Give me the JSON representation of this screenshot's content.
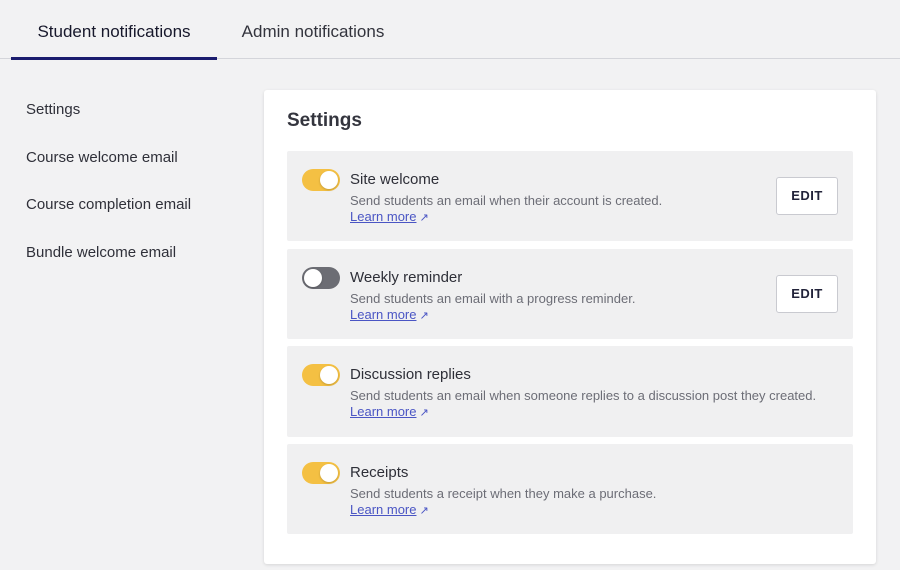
{
  "tabs": [
    {
      "label": "Student notifications",
      "active": true
    },
    {
      "label": "Admin notifications",
      "active": false
    }
  ],
  "sidebar": {
    "items": [
      {
        "label": "Settings"
      },
      {
        "label": "Course welcome email"
      },
      {
        "label": "Course completion email"
      },
      {
        "label": "Bundle welcome email"
      }
    ]
  },
  "settings": {
    "title": "Settings",
    "learn_more_label": "Learn more",
    "edit_label": "EDIT",
    "rows": [
      {
        "title": "Site welcome",
        "description": "Send students an email when their account is created.",
        "enabled": true,
        "has_edit": true
      },
      {
        "title": "Weekly reminder",
        "description": "Send students an email with a progress reminder.",
        "enabled": false,
        "has_edit": true
      },
      {
        "title": "Discussion replies",
        "description": "Send students an email when someone replies to a discussion post they created.",
        "enabled": true,
        "has_edit": false
      },
      {
        "title": "Receipts",
        "description": "Send students a receipt when they make a purchase.",
        "enabled": true,
        "has_edit": false
      }
    ]
  },
  "colors": {
    "accent": "#1b1c6e",
    "toggle_on": "#f4c043",
    "toggle_off": "#6c6d74",
    "link": "#4a55c4"
  },
  "icons": {
    "external_link": "external-link-arrow-icon"
  }
}
